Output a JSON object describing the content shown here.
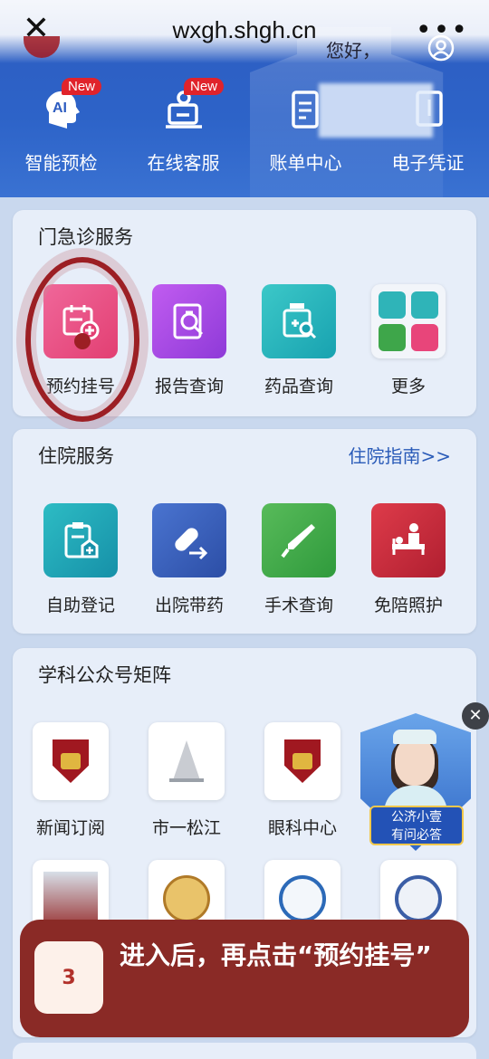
{
  "browser": {
    "url": "wxgh.shgh.cn",
    "greeting": "您好，",
    "close_label": "✕",
    "more_label": "•••"
  },
  "quick_actions": [
    {
      "label": "智能预检",
      "badge": "New",
      "icon": "ai-head-icon"
    },
    {
      "label": "在线客服",
      "badge": "New",
      "icon": "customer-service-icon"
    },
    {
      "label": "账单中心",
      "badge": "",
      "icon": "bill-icon"
    },
    {
      "label": "电子凭证",
      "badge": "",
      "icon": "certificate-icon"
    }
  ],
  "outpatient": {
    "title": "门急诊服务",
    "items": [
      {
        "label": "预约挂号",
        "icon": "calendar-plus-icon",
        "color": "#e8457a"
      },
      {
        "label": "报告查询",
        "icon": "report-search-icon",
        "color": "#a245e0"
      },
      {
        "label": "药品查询",
        "icon": "medicine-search-icon",
        "color": "#1fb3b8"
      },
      {
        "label": "更多",
        "icon": "more-grid-icon",
        "color": "#f2f5fa"
      }
    ]
  },
  "inpatient": {
    "title": "住院服务",
    "link": "住院指南>>",
    "items": [
      {
        "label": "自助登记",
        "icon": "clipboard-hospital-icon",
        "color": "#1fa3b2"
      },
      {
        "label": "出院带药",
        "icon": "pill-arrow-icon",
        "color": "#3b5fb8"
      },
      {
        "label": "手术查询",
        "icon": "scalpel-icon",
        "color": "#3ea64a"
      },
      {
        "label": "免陪照护",
        "icon": "nursing-bed-icon",
        "color": "#c8283a"
      }
    ]
  },
  "matrix": {
    "title": "学科公众号矩阵",
    "items": [
      {
        "label": "新闻订阅",
        "icon": "hospital-shield-logo"
      },
      {
        "label": "市一松江",
        "icon": "tower-logo"
      },
      {
        "label": "眼科中心",
        "icon": "hospital-shield-logo"
      }
    ],
    "row2_icons": [
      "building-photo-logo",
      "round-emblem-logo",
      "sport-emblem-logo",
      "medical-emblem-logo"
    ]
  },
  "assistant": {
    "line1": "公济小壹",
    "line2": "有问必答",
    "close": "✕"
  },
  "instruction": {
    "step": "3",
    "text": "进入后，再点击“预约挂号”"
  },
  "colors": {
    "header_blue": "#2d5cc0",
    "overlay_red": "#8a2a26",
    "annotation": "#9c1f24"
  }
}
